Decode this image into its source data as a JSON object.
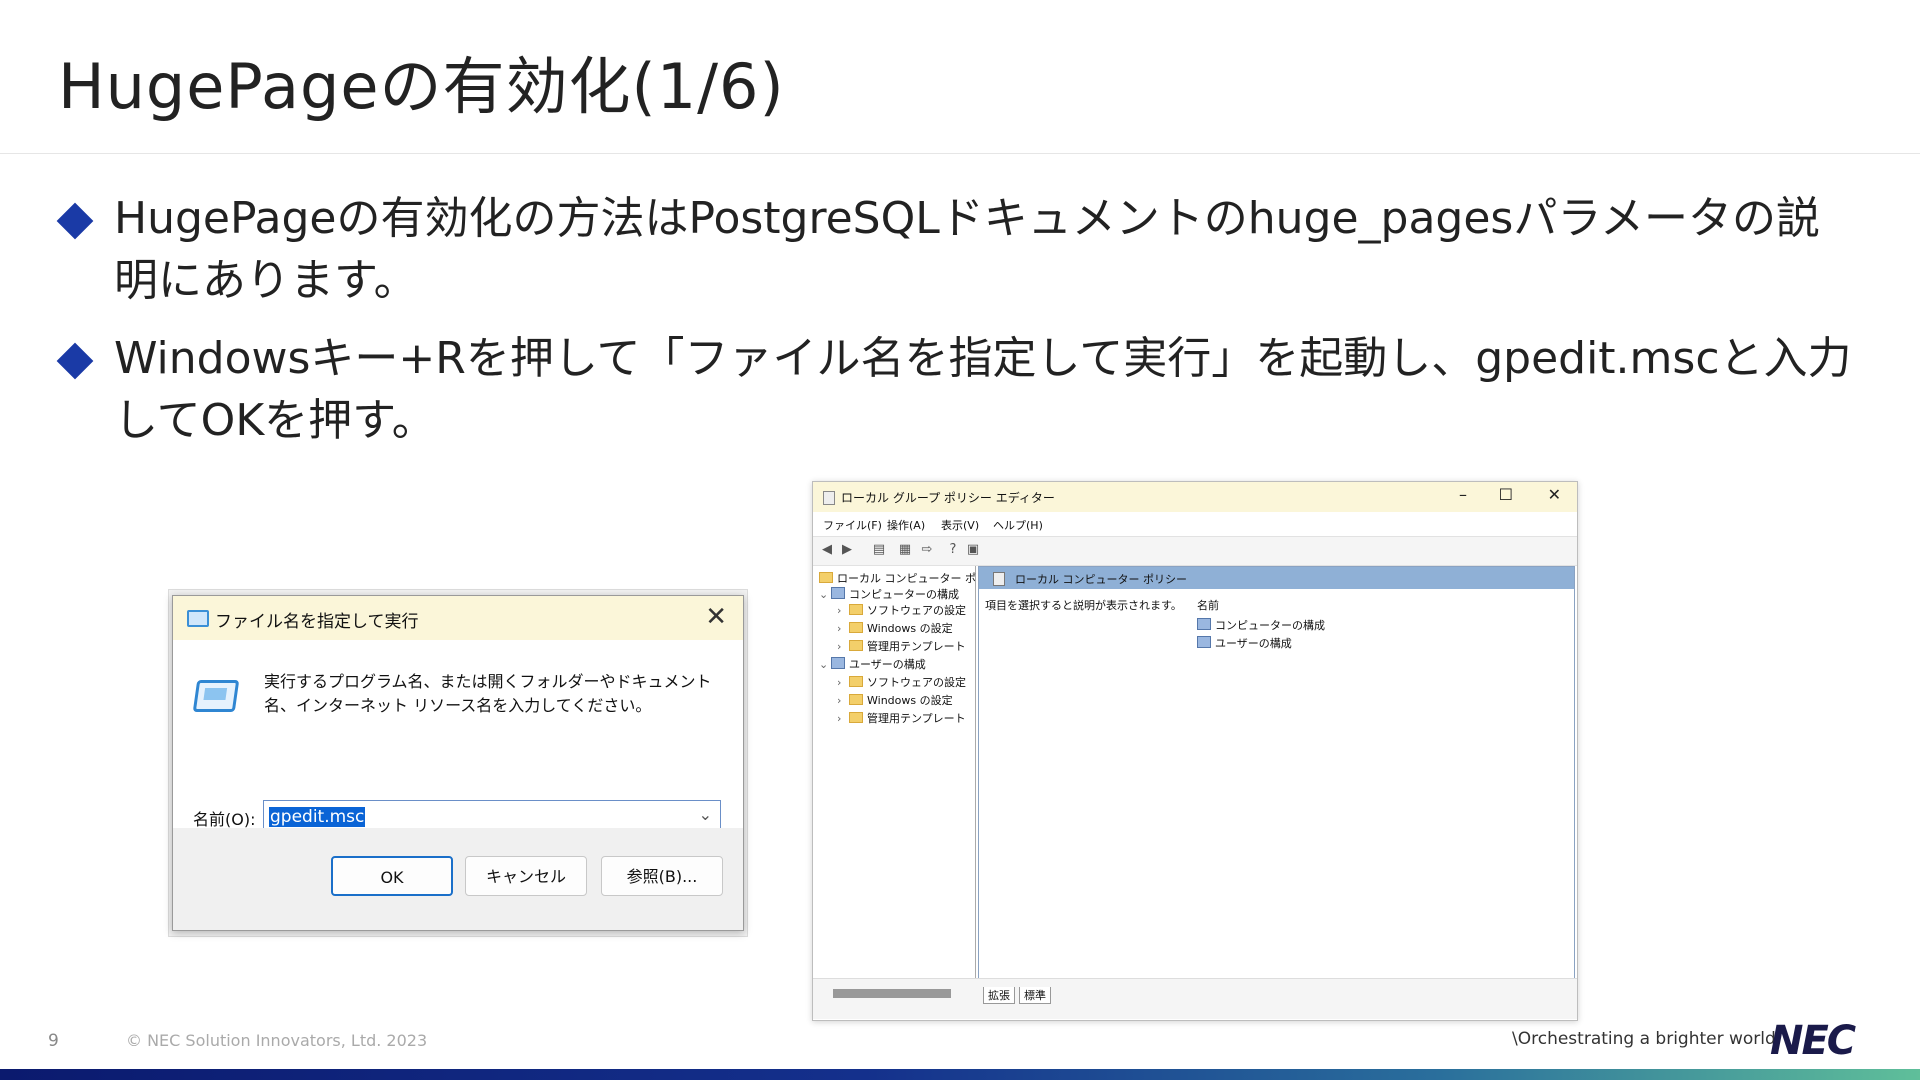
{
  "slide": {
    "title": "HugePageの有効化(1/6)",
    "bullets": [
      "HugePageの有効化の方法はPostgreSQLドキュメントのhuge_pagesパラメータの説明にあります。",
      "Windowsキー+Rを押して「ファイル名を指定して実行」を起動し、gpedit.mscと入力してOKを押す。"
    ],
    "page_number": "9",
    "copyright": "© NEC Solution Innovators, Ltd. 2023",
    "tagline": "\\Orchestrating a brighter world",
    "logo": "NEC"
  },
  "run_dialog": {
    "title": "ファイル名を指定して実行",
    "description": "実行するプログラム名、または開くフォルダーやドキュメント名、インターネット リソース名を入力してください。",
    "name_label": "名前(O):",
    "input_value": "gpedit.msc",
    "ok": "OK",
    "cancel": "キャンセル",
    "browse": "参照(B)..."
  },
  "gpo_editor": {
    "title": "ローカル グループ ポリシー エディター",
    "menu": [
      "ファイル(F)",
      "操作(A)",
      "表示(V)",
      "ヘルプ(H)"
    ],
    "tree": {
      "root": "ローカル コンピューター ポリシー",
      "computer": "コンピューターの構成",
      "user": "ユーザーの構成",
      "children": [
        "ソフトウェアの設定",
        "Windows の設定",
        "管理用テンプレート"
      ]
    },
    "right_header": "ローカル コンピューター ポリシー",
    "description": "項目を選択すると説明が表示されます。",
    "column_name": "名前",
    "items": [
      "コンピューターの構成",
      "ユーザーの構成"
    ],
    "tabs": [
      "拡張",
      "標準"
    ]
  }
}
